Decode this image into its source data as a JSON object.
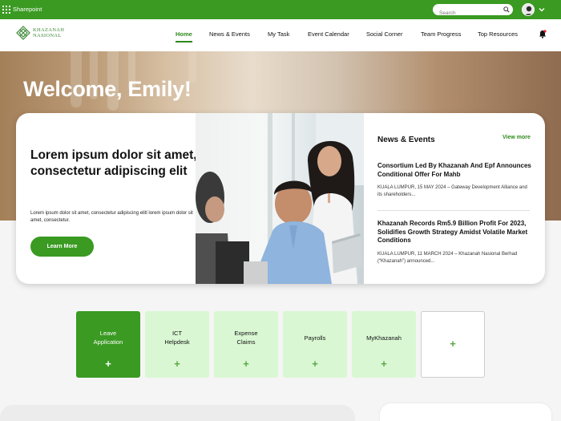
{
  "topbar": {
    "app_name": "Sharepoint",
    "search_placeholder": "Search"
  },
  "nav": {
    "logo_line1": "KHAZANAH",
    "logo_line2": "NASIONAL",
    "items": [
      {
        "label": "Home"
      },
      {
        "label": "News & Events"
      },
      {
        "label": "My Task"
      },
      {
        "label": "Event Calendar"
      },
      {
        "label": "Social Corner"
      },
      {
        "label": "Team Progress"
      },
      {
        "label": "Top Resources"
      }
    ]
  },
  "hero": {
    "welcome": "Welcome, Emily!"
  },
  "feature": {
    "title": "Lorem ipsum dolor sit amet, consectetur adipiscing elit",
    "body": "Lorem ipsum dolor sit amet, consectetur adipiscing elitl lorem ipsum dolor sit amet, consectetur.",
    "button": "Learn More"
  },
  "news": {
    "title": "News & Events",
    "view_more": "View more",
    "items": [
      {
        "headline": "Consortium Led By Khazanah And Epf Announces Conditional Offer For Mahb",
        "summary": "KUALA LUMPUR, 15 MAY 2024 – Gateway Development Alliance and its shareholders..."
      },
      {
        "headline": "Khazanah Records Rm5.9 Billion Profit For 2023, Solidifies Growth Strategy Amidst Volatile Market Conditions",
        "summary": "KUALA LUMPUR, 11 MARCH 2024 – Khazanah Nasional Berhad (“Khazanah”) announced..."
      }
    ]
  },
  "quick_links": [
    {
      "line1": "Leave",
      "line2": "Application",
      "active": true
    },
    {
      "line1": "ICT",
      "line2": "Helpdesk",
      "active": false
    },
    {
      "line1": "Expense",
      "line2": "Claims",
      "active": false
    },
    {
      "line1": "Payrolls",
      "line2": "",
      "active": false
    },
    {
      "line1": "MyKhazanah",
      "line2": "",
      "active": false
    }
  ],
  "add_symbol": "+",
  "colors": {
    "brand_green": "#3a9a22",
    "tile_light": "#d9f7d3",
    "link_green": "#2f8a1e"
  },
  "icons": [
    "app-launcher-icon",
    "search-icon",
    "chevron-down-icon",
    "bell-icon",
    "plus-icon"
  ]
}
